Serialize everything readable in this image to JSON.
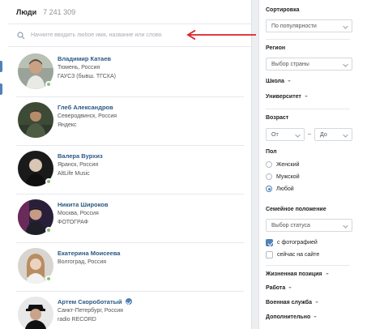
{
  "header": {
    "title": "Люди",
    "count": "7 241 309"
  },
  "search": {
    "placeholder": "Начните вводить любое имя, название или слово"
  },
  "people": [
    {
      "name": "Владимир Катаев",
      "line1": "Тюмень, Россия",
      "line2": "ГАУСЗ (бывш. ТГСХА)",
      "online": true,
      "verified": false
    },
    {
      "name": "Глеб Александров",
      "line1": "Северодвинск, Россия",
      "line2": "Яндекс",
      "online": false,
      "verified": false
    },
    {
      "name": "Валера Вурхиз",
      "line1": "Ярaнск, Россия",
      "line2": "AltLife Music",
      "online": true,
      "verified": false
    },
    {
      "name": "Никита Широков",
      "line1": "Москва, Россия",
      "line2": "ФОТОГРАФ",
      "online": true,
      "verified": false
    },
    {
      "name": "Екатерина Моисеева",
      "line1": "Волгоград, Россия",
      "line2": "",
      "online": true,
      "verified": false
    },
    {
      "name": "Артем Скороботатый",
      "line1": "Санкт-Петербург, Россия",
      "line2": "radio RECORD",
      "online": false,
      "verified": true
    }
  ],
  "filters": {
    "sort_label": "Сортировка",
    "sort_value": "По популярности",
    "region_label": "Регион",
    "region_value": "Выбор страны",
    "school_label": "Школа",
    "university_label": "Университет",
    "age_label": "Возраст",
    "age_from": "От",
    "age_dash": "–",
    "age_to": "До",
    "gender_label": "Пол",
    "gender_options": [
      "Женский",
      "Мужской",
      "Любой"
    ],
    "gender_selected": "Любой",
    "marital_label": "Семейное положение",
    "marital_value": "Выбор статуса",
    "with_photo_label": "с фотографией",
    "with_photo_checked": true,
    "online_label": "сейчас на сайте",
    "online_checked": false,
    "life_position_label": "Жизненная позиция",
    "work_label": "Работа",
    "military_label": "Военная служба",
    "additional_label": "Дополнительно"
  },
  "colors": {
    "link": "#2a5885",
    "accent": "#5181b8",
    "online": "#8ac176",
    "arrow": "#d9202a"
  }
}
